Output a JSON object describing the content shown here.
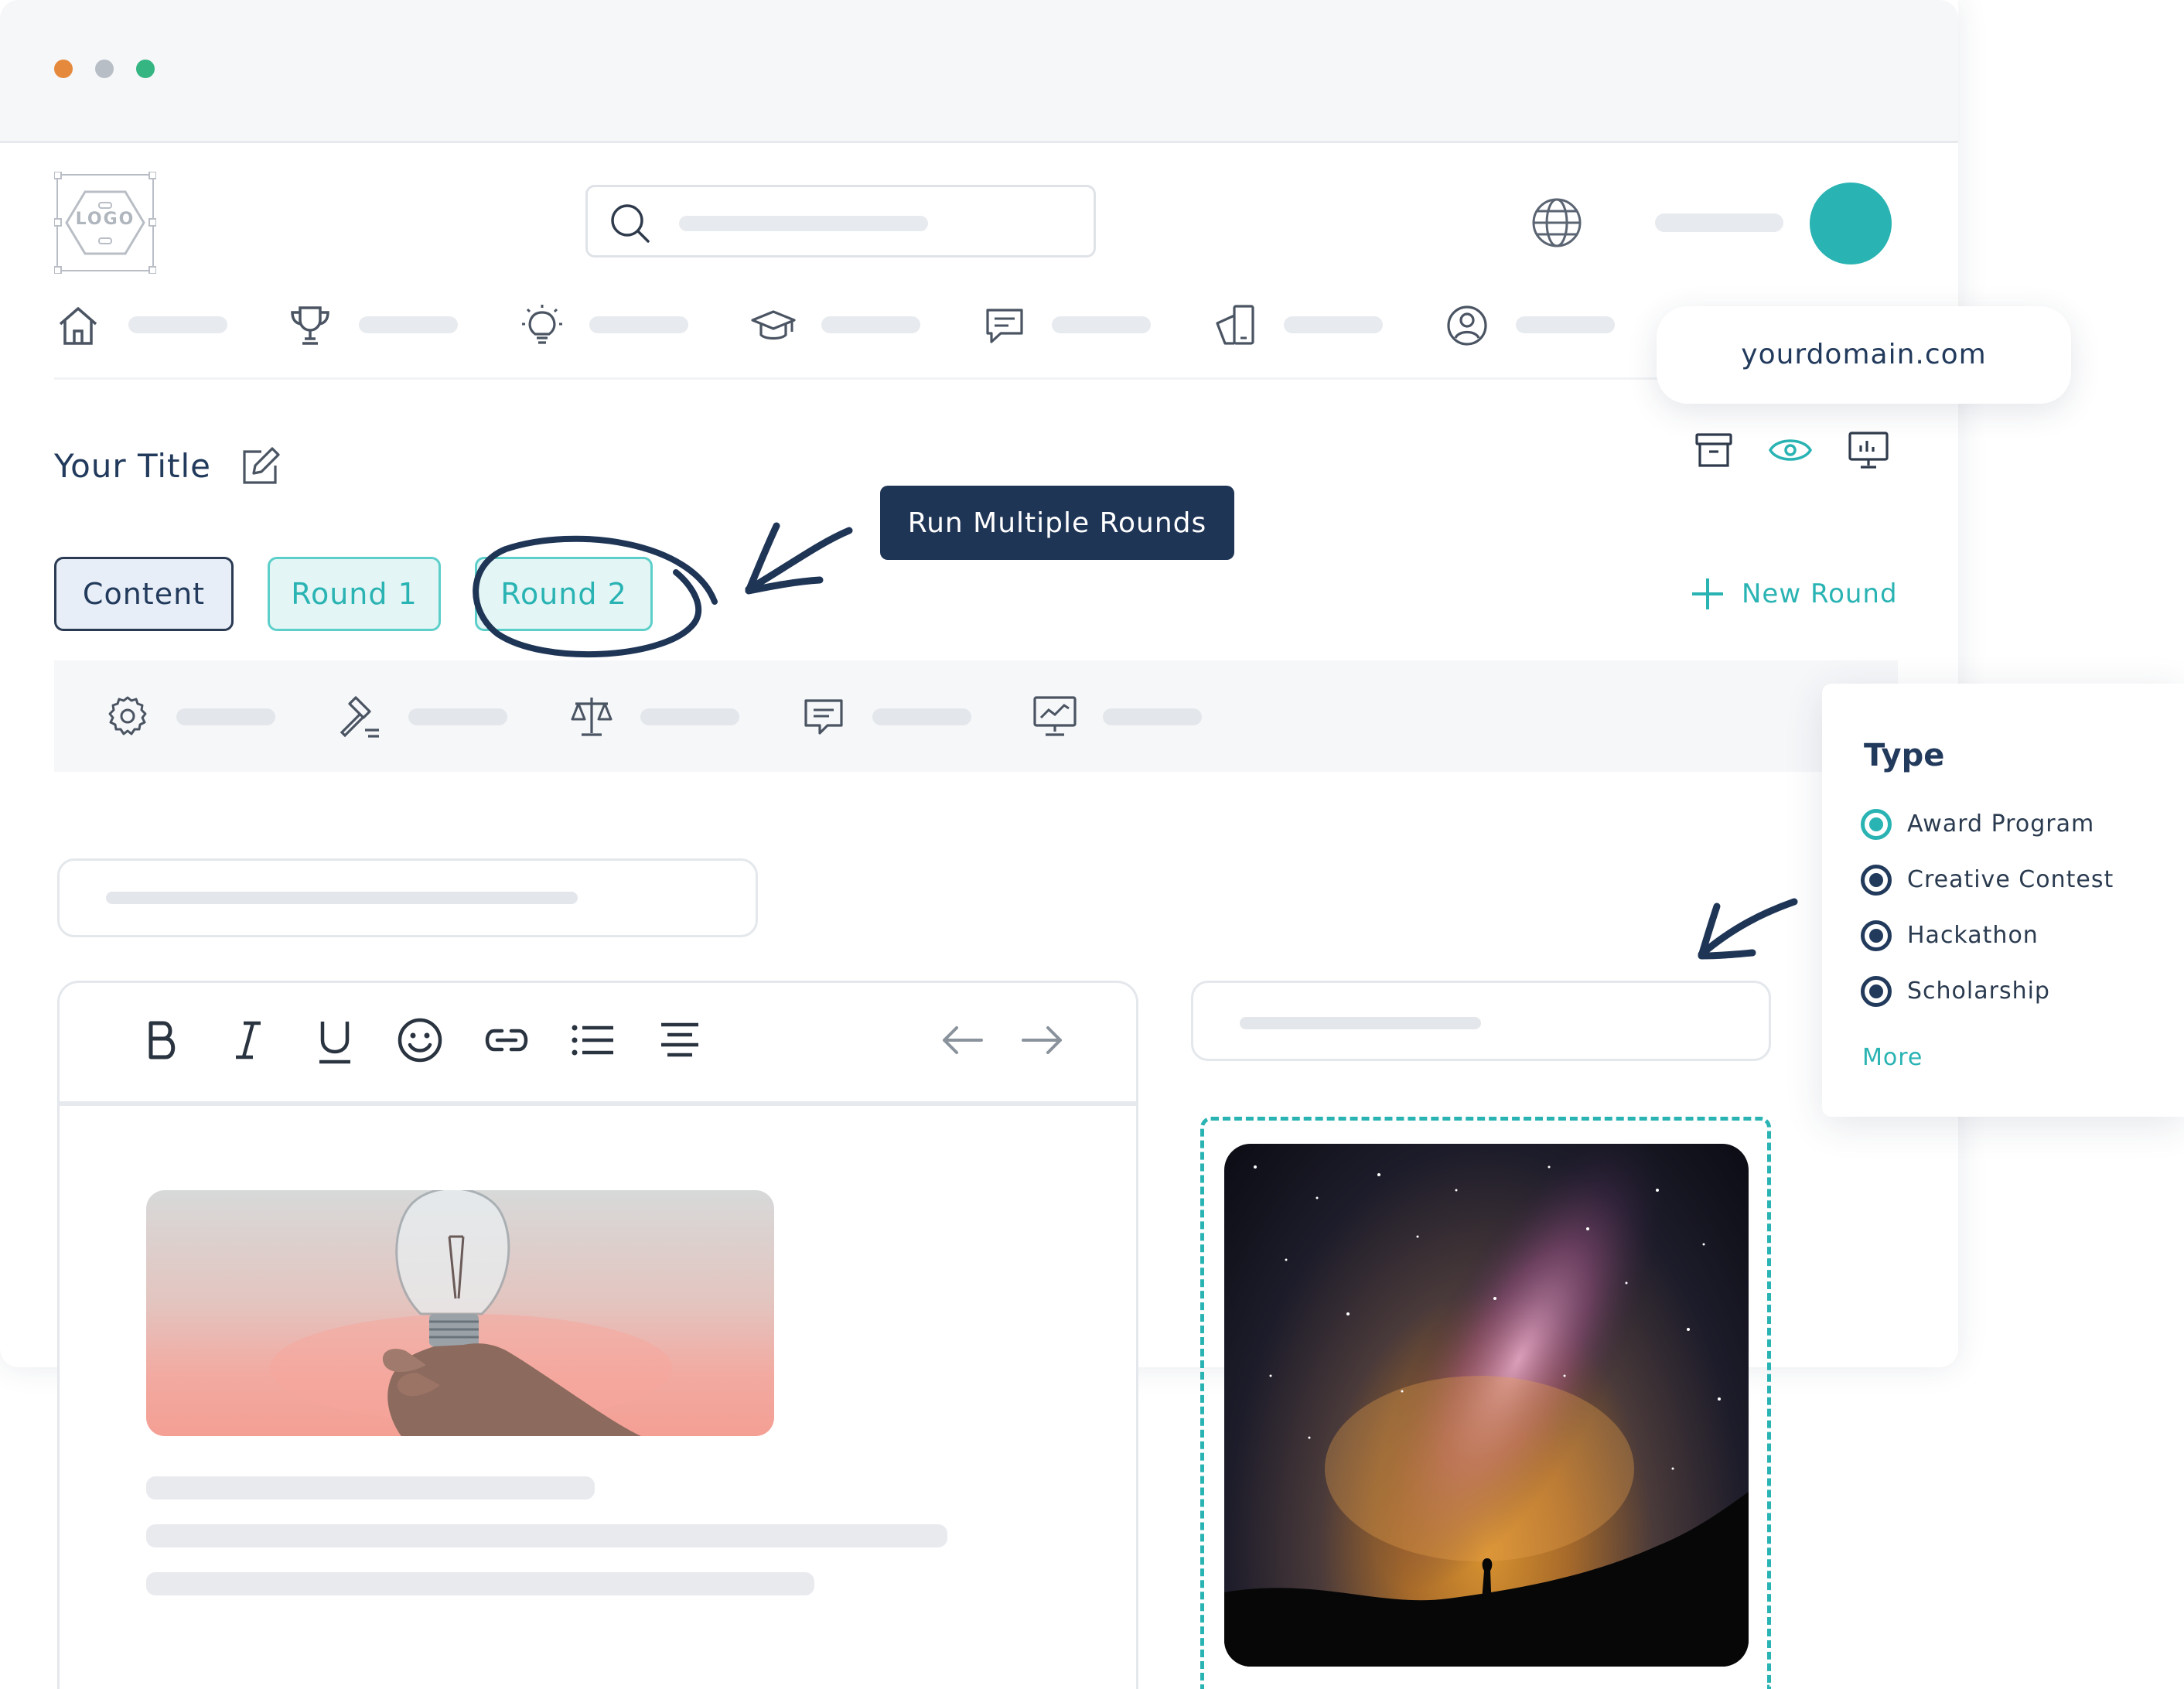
{
  "header": {
    "logo_text": "LOGO",
    "search": {
      "placeholder": ""
    }
  },
  "page": {
    "title": "Your Title"
  },
  "tabs": [
    {
      "label": "Content"
    },
    {
      "label": "Round 1"
    },
    {
      "label": "Round 2"
    }
  ],
  "new_round_label": "New Round",
  "callout": "Run Multiple Rounds",
  "domain_popup": {
    "url": "yourdomain.com"
  },
  "type_panel": {
    "title": "Type",
    "options": [
      {
        "label": "Award Program",
        "selected": true
      },
      {
        "label": "Creative Contest",
        "selected": false
      },
      {
        "label": "Hackathon",
        "selected": false
      },
      {
        "label": "Scholarship",
        "selected": false
      }
    ],
    "more_label": "More"
  },
  "colors": {
    "accent": "#2ab3b3",
    "navy": "#223a5c",
    "dot_orange": "#e58a3c",
    "dot_gray": "#b8bec6",
    "dot_green": "#34b582"
  },
  "icons": {
    "nav": [
      "home-icon",
      "trophy-icon",
      "lightbulb-icon",
      "graduation-cap-icon",
      "chat-icon",
      "mobile-icon",
      "user-icon"
    ],
    "subnav": [
      "gear-icon",
      "gavel-icon",
      "scales-icon",
      "chat-icon",
      "presentation-icon"
    ],
    "toolbar": [
      "bold-icon",
      "italic-icon",
      "underline-icon",
      "emoji-icon",
      "link-icon",
      "list-icon",
      "align-center-icon",
      "undo-arrow-icon",
      "redo-arrow-icon"
    ]
  }
}
